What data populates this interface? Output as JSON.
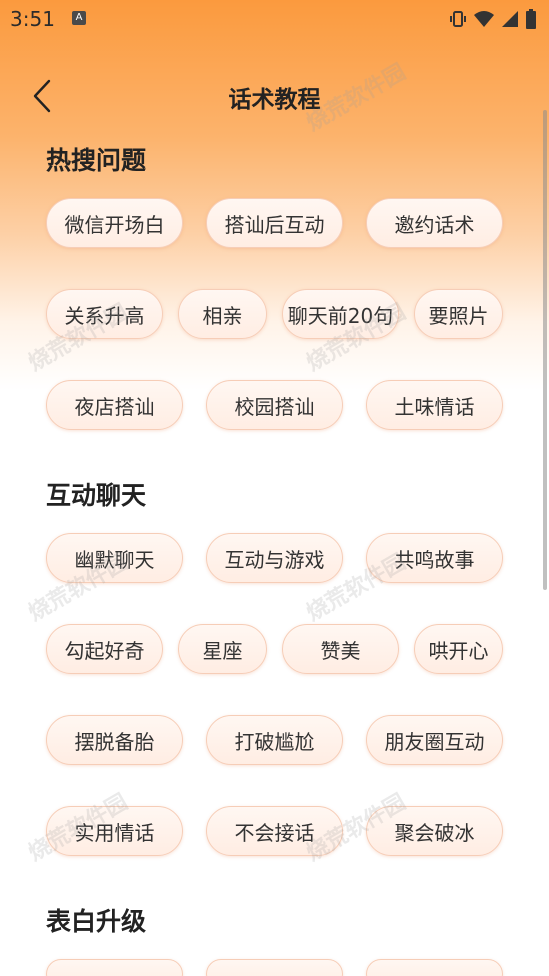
{
  "status_bar": {
    "time": "3:51",
    "notification_badge": "A",
    "icons": [
      "vibrate-icon",
      "wifi-icon",
      "signal-icon",
      "battery-icon"
    ]
  },
  "header": {
    "title": "话术教程",
    "back_icon": "chevron-left-icon"
  },
  "watermark": "烧荒软件园",
  "sections": [
    {
      "title": "热搜问题",
      "rows": [
        [
          "微信开场白",
          "搭讪后互动",
          "邀约话术"
        ],
        [
          "关系升高",
          "相亲",
          "聊天前20句",
          "要照片"
        ],
        [
          "夜店搭讪",
          "校园搭讪",
          "土味情话"
        ]
      ]
    },
    {
      "title": "互动聊天",
      "rows": [
        [
          "幽默聊天",
          "互动与游戏",
          "共鸣故事"
        ],
        [
          "勾起好奇",
          "星座",
          "赞美",
          "哄开心"
        ],
        [
          "摆脱备胎",
          "打破尴尬",
          "朋友圈互动"
        ],
        [
          "实用情话",
          "不会接话",
          "聚会破冰"
        ]
      ]
    },
    {
      "title": "表白升级"
    }
  ],
  "colors": {
    "header_gradient_top": "#fb9a3e",
    "chip_border": "#f6cdb7",
    "chip_fill": "#fff3ec"
  }
}
